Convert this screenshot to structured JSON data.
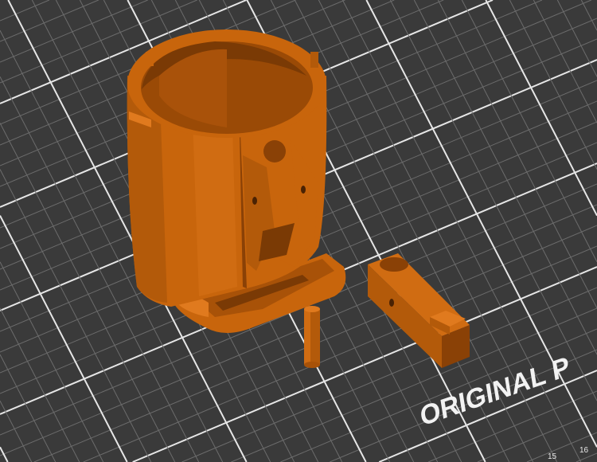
{
  "viewport": {
    "bed_label": "ORIGINAL P",
    "ruler_ticks": [
      "15",
      "16"
    ],
    "colors": {
      "background": "#3a3a3a",
      "model": "#c8650c",
      "model_dark": "#8a4106",
      "grid_major": "#e6e6e6",
      "grid_minor": "#6c6c6c"
    }
  },
  "objects": [
    {
      "name": "cup-holder"
    },
    {
      "name": "pin"
    },
    {
      "name": "clip-block"
    }
  ]
}
